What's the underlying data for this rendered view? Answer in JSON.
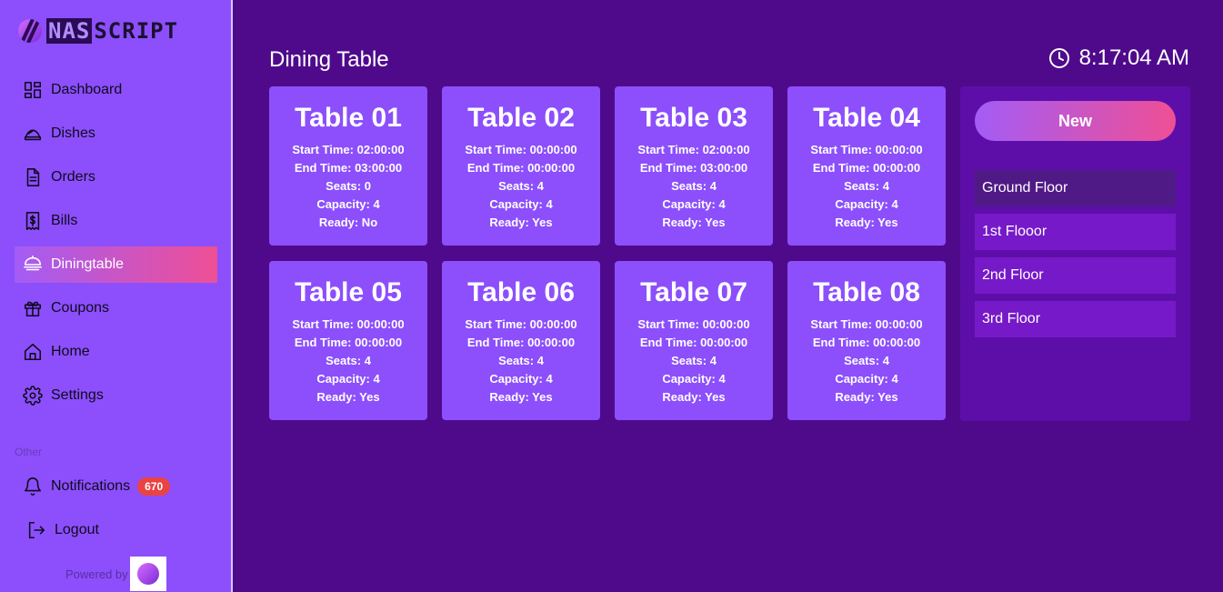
{
  "brand": {
    "part1": "NAS",
    "part2": "SCRIPT"
  },
  "sidebar": {
    "items": [
      {
        "label": "Dashboard",
        "icon": "dashboard-icon"
      },
      {
        "label": "Dishes",
        "icon": "dish-icon"
      },
      {
        "label": "Orders",
        "icon": "orders-icon"
      },
      {
        "label": "Bills",
        "icon": "bills-icon"
      },
      {
        "label": "Diningtable",
        "icon": "dining-table-icon",
        "active": true
      },
      {
        "label": "Coupons",
        "icon": "gift-icon"
      },
      {
        "label": "Home",
        "icon": "home-icon"
      },
      {
        "label": "Settings",
        "icon": "gear-icon"
      }
    ],
    "section_label": "Other",
    "notifications": {
      "label": "Notifications",
      "count": "670"
    },
    "logout": "Logout",
    "powered_by": "Powered by"
  },
  "header": {
    "title": "Dining Table",
    "time": "8:17:04 AM"
  },
  "tables": [
    {
      "name": "Table 01",
      "start": "Start Time: 02:00:00",
      "end": "End Time: 03:00:00",
      "seats": "Seats: 0",
      "capacity": "Capacity: 4",
      "ready": "Ready: No"
    },
    {
      "name": "Table 02",
      "start": "Start Time: 00:00:00",
      "end": "End Time: 00:00:00",
      "seats": "Seats: 4",
      "capacity": "Capacity: 4",
      "ready": "Ready: Yes"
    },
    {
      "name": "Table 03",
      "start": "Start Time: 02:00:00",
      "end": "End Time: 03:00:00",
      "seats": "Seats: 4",
      "capacity": "Capacity: 4",
      "ready": "Ready: Yes"
    },
    {
      "name": "Table 04",
      "start": "Start Time: 00:00:00",
      "end": "End Time: 00:00:00",
      "seats": "Seats: 4",
      "capacity": "Capacity: 4",
      "ready": "Ready: Yes"
    },
    {
      "name": "Table 05",
      "start": "Start Time: 00:00:00",
      "end": "End Time: 00:00:00",
      "seats": "Seats: 4",
      "capacity": "Capacity: 4",
      "ready": "Ready: Yes"
    },
    {
      "name": "Table 06",
      "start": "Start Time: 00:00:00",
      "end": "End Time: 00:00:00",
      "seats": "Seats: 4",
      "capacity": "Capacity: 4",
      "ready": "Ready: Yes"
    },
    {
      "name": "Table 07",
      "start": "Start Time: 00:00:00",
      "end": "End Time: 00:00:00",
      "seats": "Seats: 4",
      "capacity": "Capacity: 4",
      "ready": "Ready: Yes"
    },
    {
      "name": "Table 08",
      "start": "Start Time: 00:00:00",
      "end": "End Time: 00:00:00",
      "seats": "Seats: 4",
      "capacity": "Capacity: 4",
      "ready": "Ready: Yes"
    }
  ],
  "panel": {
    "new_label": "New",
    "floors": [
      "Ground Floor",
      "1st Flooor",
      "2nd Floor",
      "3rd Floor"
    ],
    "selected_floor": "Ground Floor"
  },
  "colors": {
    "background": "#4f0a8c",
    "sidebar": "#8c4ffb",
    "card": "#8c4ffb",
    "accent_gradient_start": "#a35cf6",
    "accent_gradient_end": "#ef4f95",
    "badge": "#e94343"
  }
}
